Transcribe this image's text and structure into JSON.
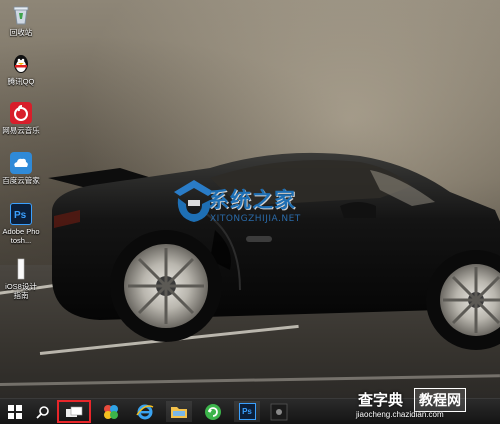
{
  "desktop_icons": [
    {
      "name": "recycle-bin",
      "label": "回收站",
      "icon": "recycle-bin-icon"
    },
    {
      "name": "tencent-qq",
      "label": "腾讯QQ",
      "icon": "qq-penguin-icon"
    },
    {
      "name": "netease-music",
      "label": "网易云音乐",
      "icon": "music-icon"
    },
    {
      "name": "baidu-cloud",
      "label": "百度云管家",
      "icon": "cloud-icon"
    },
    {
      "name": "photoshop",
      "label": "Adobe Photosh...",
      "icon": "ps-icon"
    },
    {
      "name": "ios8-guide",
      "label": "iOS8设计指南",
      "icon": "document-icon"
    }
  ],
  "watermark": {
    "title": "系统之家",
    "subtitle": "XITONGZHIJIA.NET"
  },
  "taskbar": {
    "items": [
      {
        "name": "start-button",
        "icon": "windows-logo-icon"
      },
      {
        "name": "search-button",
        "icon": "search-icon"
      },
      {
        "name": "task-view-button",
        "icon": "task-view-icon"
      },
      {
        "name": "taskbar-app-pinwheel",
        "icon": "pinwheel-icon"
      },
      {
        "name": "taskbar-app-ie",
        "icon": "ie-icon"
      },
      {
        "name": "taskbar-app-explorer",
        "icon": "folder-icon"
      },
      {
        "name": "taskbar-app-update",
        "icon": "refresh-icon"
      },
      {
        "name": "taskbar-app-photoshop",
        "icon": "ps-icon",
        "text": "Ps"
      },
      {
        "name": "taskbar-app-dark",
        "icon": "app-icon"
      }
    ]
  },
  "brand": {
    "main": "查字典",
    "box": "教程网",
    "url": "jiaocheng.chazidian.com"
  },
  "colors": {
    "highlight": "#e8262a",
    "watermark_blue": "#1e6fb4"
  }
}
